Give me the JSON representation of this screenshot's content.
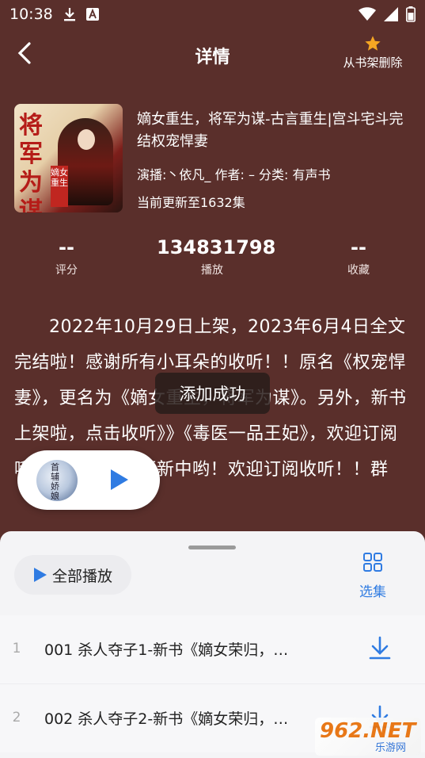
{
  "status_bar": {
    "time": "10:38"
  },
  "header": {
    "title": "详情",
    "remove_label": "从书架删除"
  },
  "book": {
    "title": "嫡女重生，将军为谋-古言重生|宫斗宅斗完结权宠悍妻",
    "meta": "演播:丶依凡_ 作者: – 分类: 有声书",
    "update": "当前更新至1632集",
    "cover_title": "将军为谋",
    "cover_seal": "嫡女重生"
  },
  "stats": [
    {
      "value": "--",
      "label": "评分"
    },
    {
      "value": "134831798",
      "label": "播放"
    },
    {
      "value": "--",
      "label": "收藏"
    }
  ],
  "description": "2022年10月29日上架，2023年6月4日全文完结啦！感谢所有小耳朵的收听！！原名《权宠悍妻》，更名为《嫡女重生，将军为谋》。另外，新书上架啦，点击收听》》《毒医一品王妃》，欢迎订阅哦！本专辑付费更新中哟！欢迎订阅收听！！群",
  "toast": "添加成功",
  "mini_player": {
    "cover_text": "首辅娇娘"
  },
  "panel": {
    "play_all_label": "全部播放",
    "select_label": "选集",
    "episodes": [
      {
        "num": "1",
        "title": "001 杀人夺子1-新书《嫡女荣归，…"
      },
      {
        "num": "2",
        "title": "002 杀人夺子2-新书《嫡女荣归，…"
      }
    ]
  },
  "watermark": {
    "big": "962.NET",
    "small": "乐游网"
  },
  "colors": {
    "background": "#5a2f2b",
    "accent_blue": "#2f7be2",
    "star": "#f5a623"
  }
}
